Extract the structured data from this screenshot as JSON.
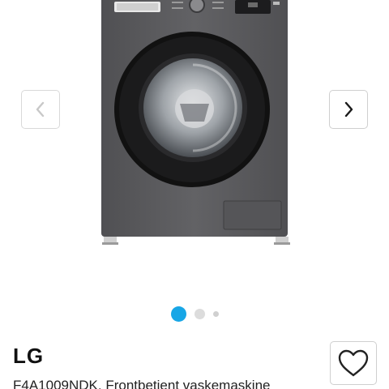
{
  "product": {
    "brand": "LG",
    "title": "F4A1009NDK, Frontbetjent vaskemaskine"
  },
  "gallery": {
    "total_images": 3,
    "active_index": 0
  },
  "icons": {
    "prev": "chevron-left-icon",
    "next": "chevron-right-icon",
    "favorite": "heart-icon"
  },
  "colors": {
    "accent": "#17a6e6",
    "machine_body": "#5a5a5c",
    "door_ring": "#111111"
  }
}
